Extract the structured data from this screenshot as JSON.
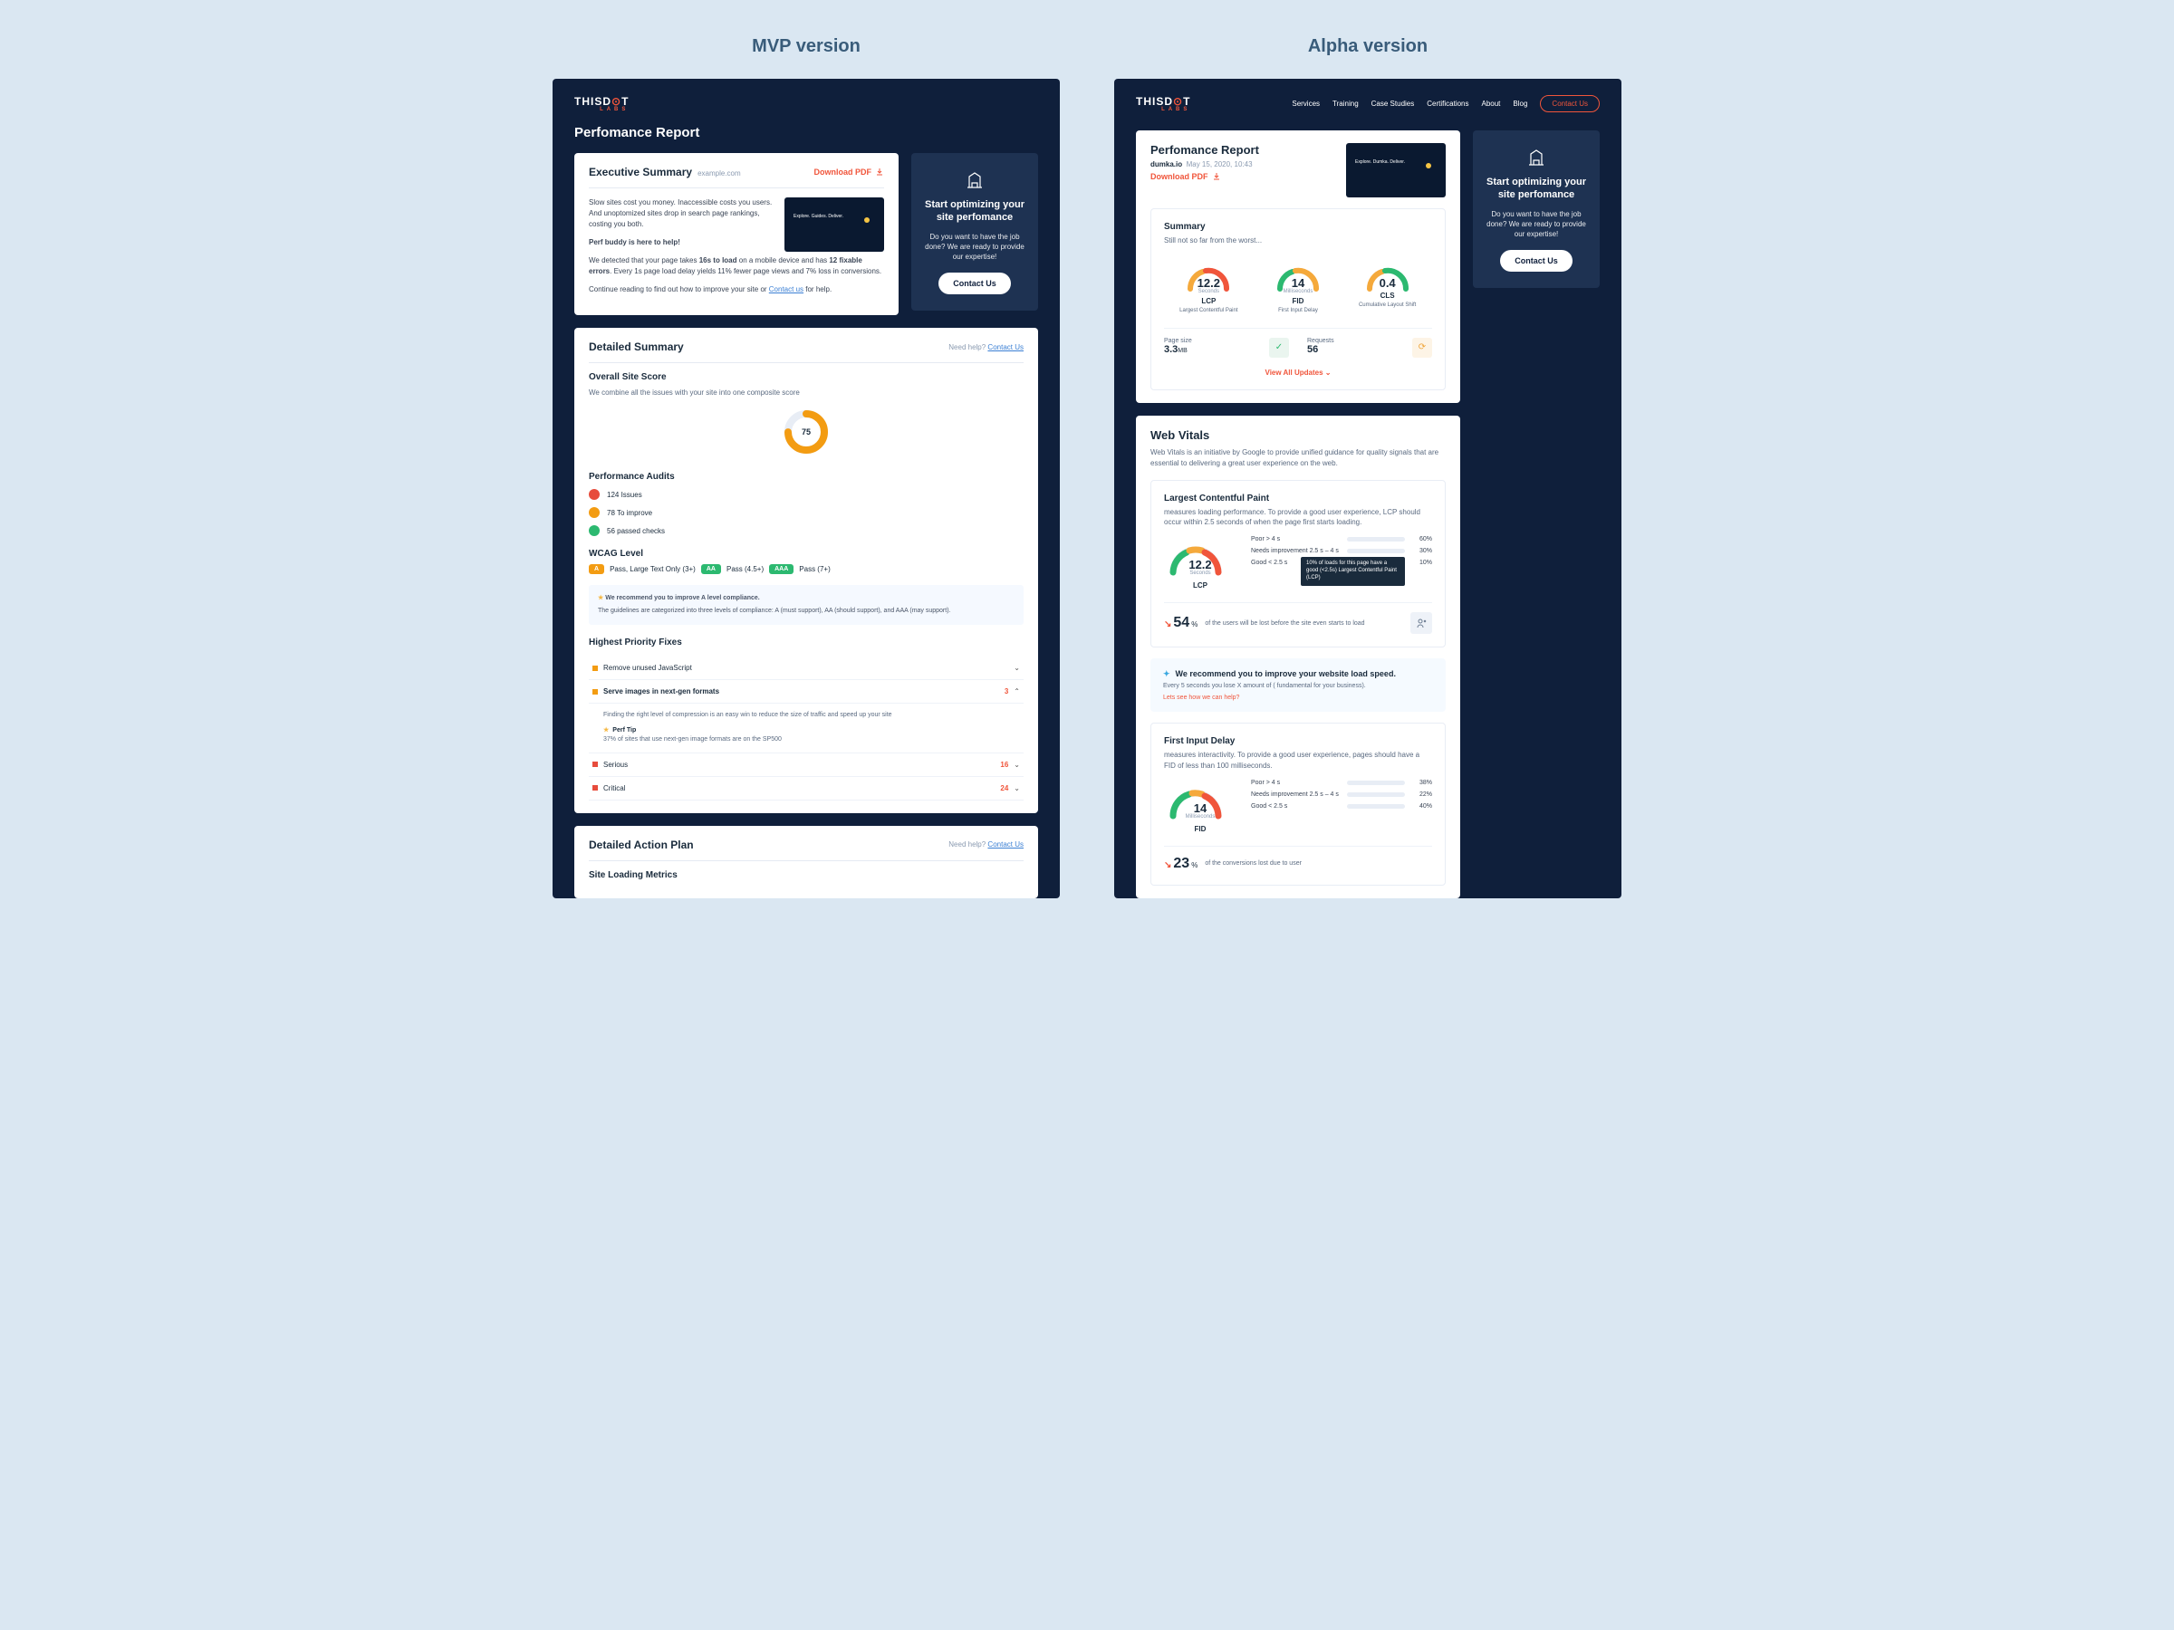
{
  "labels": {
    "mvp_heading": "MVP version",
    "alpha_heading": "Alpha version"
  },
  "nav": {
    "items": [
      "Services",
      "Training",
      "Case Studies",
      "Certifications",
      "About",
      "Blog"
    ],
    "contact": "Contact Us"
  },
  "cta": {
    "title": "Start optimizing your site perfomance",
    "body": "Do you want to have the job done? We are ready to provide our expertise!",
    "button": "Contact Us"
  },
  "mvp": {
    "page_title": "Perfomance Report",
    "exec": {
      "title": "Executive Summary",
      "domain": "example.com",
      "download": "Download PDF",
      "p1": "Slow sites cost you money. Inaccessible costs you users. And unoptomized sites drop in search page rankings, costing you both.",
      "p2": "Perf buddy is here to help!",
      "p3_pre": "We detected that your page takes ",
      "p3_b1": "16s to load",
      "p3_mid": " on a mobile device and has ",
      "p3_b2": "12 fixable errors",
      "p3_post": ". Every 1s page load delay yields 11% fewer page views and 7% loss in conversions.",
      "p4_pre": "Continue reading to find out how to improve your site or ",
      "p4_link": "Contact us",
      "p4_post": " for help.",
      "thumb_text": "Explore. Guides. Deliver."
    },
    "detailed": {
      "title": "Detailed Summary",
      "help_pre": "Need help? ",
      "help_link": "Contact Us",
      "score_title": "Overall Site Score",
      "score_desc": "We combine all the issues with your site into one composite score",
      "score_value": "75",
      "audits_title": "Performance Audits",
      "audits": [
        {
          "color": "#e74c3c",
          "text": "124 Issues"
        },
        {
          "color": "#f39c12",
          "text": "78 To improve"
        },
        {
          "color": "#2cb970",
          "text": "56 passed checks"
        }
      ],
      "wcag_title": "WCAG Level",
      "wcag": {
        "a": "A",
        "a_text": "Pass, Large Text Only (3+)",
        "aa": "AA",
        "aa_text": "Pass (4.5+)",
        "aaa": "AAA",
        "aaa_text": "Pass (7+)"
      },
      "wcag_reco_head": "We recommend you to improve A level compliance.",
      "wcag_reco_body": "The guidelines are categorized into three levels of compliance: A (must support), AA (should support), and AAA (may support).",
      "fixes_title": "Highest Priority Fixes",
      "fixes": [
        {
          "name": "Remove unused JavaScript",
          "color": "#f39c12"
        },
        {
          "name": "Serve images in next-gen formats",
          "color": "#f39c12",
          "count": "3",
          "expanded": true,
          "body": "Finding the right level of compression is an easy win to reduce the size of traffic and speed up your site",
          "tip_head": "Perf Tip",
          "tip_body": "37% of sites that use next-gen image formats are on the SP500"
        },
        {
          "name": "Serious",
          "color": "#e74c3c",
          "count": "16"
        },
        {
          "name": "Critical",
          "color": "#e74c3c",
          "count": "24"
        }
      ]
    },
    "action_plan": {
      "title": "Detailed Action Plan",
      "sub": "Site Loading Metrics"
    }
  },
  "alpha": {
    "report": {
      "title": "Perfomance Report",
      "domain": "dumka.io",
      "date": "May 15, 2020, 10:43",
      "download": "Download PDF",
      "thumb_text": "Explore. Dumka. Deliver."
    },
    "summary": {
      "title": "Summary",
      "subtitle": "Still not so far from the worst...",
      "gauges": [
        {
          "value": "12.2",
          "unit": "Seconds",
          "abbr": "LCP",
          "full": "Largest Contentful Paint"
        },
        {
          "value": "14",
          "unit": "Milliseconds",
          "abbr": "FID",
          "full": "First Input Delay"
        },
        {
          "value": "0.4",
          "unit": "",
          "abbr": "CLS",
          "full": "Cumulative Layout Shift"
        }
      ],
      "stats": [
        {
          "label": "Page size",
          "value": "3.3",
          "unit": "MB"
        },
        {
          "label": "Requests",
          "value": "56",
          "unit": ""
        }
      ],
      "view_all": "View All Updates"
    },
    "vitals": {
      "title": "Web Vitals",
      "desc": "Web Vitals is an initiative by Google to provide unified guidance for quality signals that are essential to delivering a great user experience on the web.",
      "lcp": {
        "title": "Largest Contentful Paint",
        "desc": "measures loading performance. To provide a good user experience, LCP should occur within 2.5 seconds of when the page first starts loading.",
        "gauge_value": "12.2",
        "gauge_unit": "Seconds",
        "gauge_abbr": "LCP",
        "bars": [
          {
            "label": "Poor > 4 s",
            "pct": "60%",
            "fill": 60,
            "color": "#f0553b"
          },
          {
            "label": "Needs improvement 2.5 s – 4 s",
            "pct": "30%",
            "fill": 30,
            "color": "#f5a93b"
          },
          {
            "label": "Good < 2.5 s",
            "pct": "10%",
            "fill": 10,
            "color": "#2cb970"
          }
        ],
        "tooltip": "10% of loads for this page have a good (<2.5s) Largest Contentful Paint (LCP)",
        "footer_pct": "54",
        "footer_text": "of the users will be lost before the site even starts to load"
      },
      "reco": {
        "head": "We recommend you to improve your website load speed.",
        "body": "Every 5 seconds you lose X amount of ( fundamental for your business).",
        "link": "Lets see how we can help?"
      },
      "fid": {
        "title": "First Input Delay",
        "desc": "measures interactivity. To provide a good user experience, pages should have a FID of less than 100 milliseconds.",
        "gauge_value": "14",
        "gauge_unit": "Milliseconds",
        "gauge_abbr": "FID",
        "bars": [
          {
            "label": "Poor > 4 s",
            "pct": "38%",
            "fill": 38,
            "color": "#f0553b"
          },
          {
            "label": "Needs improvement 2.5 s – 4 s",
            "pct": "22%",
            "fill": 22,
            "color": "#f5a93b"
          },
          {
            "label": "Good < 2.5 s",
            "pct": "40%",
            "fill": 40,
            "color": "#2cb970"
          }
        ],
        "footer_pct": "23",
        "footer_text": "of the conversions lost due to user"
      }
    }
  },
  "chart_data": [
    {
      "type": "pie",
      "title": "Overall Site Score donut",
      "values": [
        75,
        25
      ],
      "categories": [
        "score",
        "remainder"
      ]
    },
    {
      "type": "bar",
      "title": "LCP distribution",
      "categories": [
        "Poor > 4 s",
        "Needs improvement 2.5–4 s",
        "Good < 2.5 s"
      ],
      "values": [
        60,
        30,
        10
      ],
      "ylim": [
        0,
        100
      ],
      "ylabel": "%"
    },
    {
      "type": "bar",
      "title": "FID distribution",
      "categories": [
        "Poor > 4 s",
        "Needs improvement 2.5–4 s",
        "Good < 2.5 s"
      ],
      "values": [
        38,
        22,
        40
      ],
      "ylim": [
        0,
        100
      ],
      "ylabel": "%"
    }
  ]
}
